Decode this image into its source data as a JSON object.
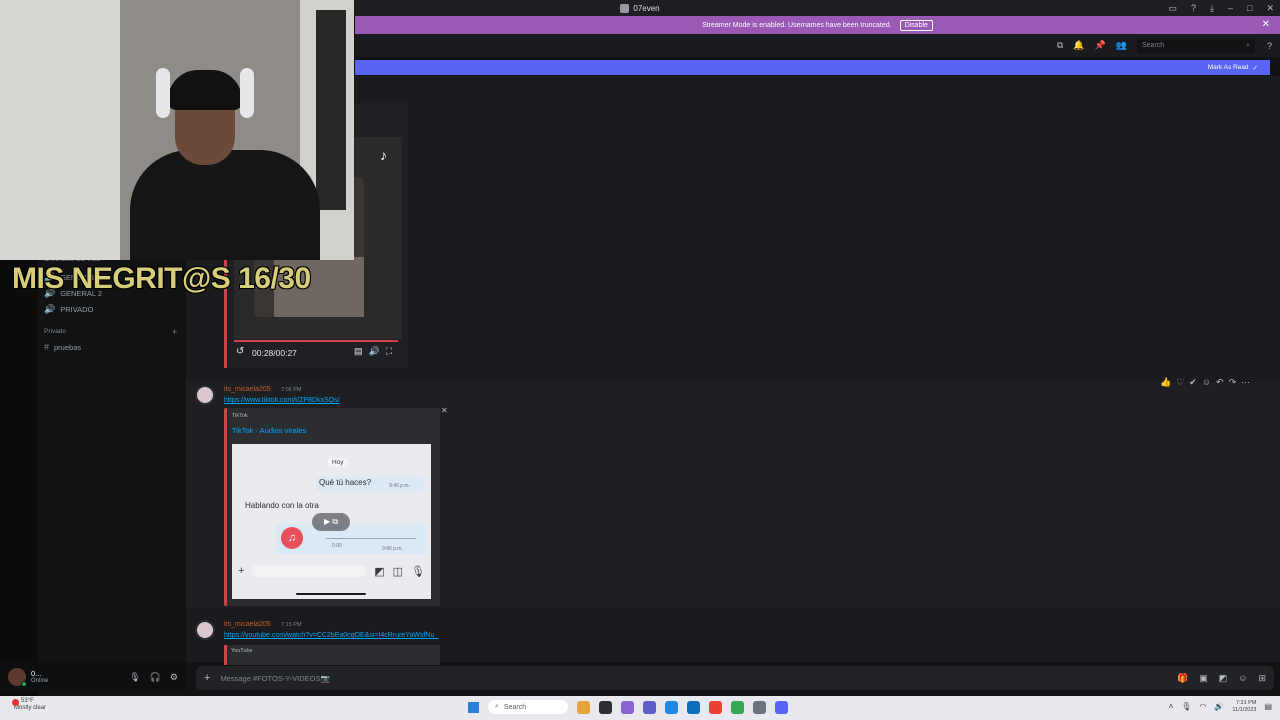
{
  "window": {
    "title": "07even"
  },
  "banner": {
    "text": "Streamer Mode is enabled. Usernames have been truncated.",
    "disable_label": "Disable"
  },
  "header": {
    "search_placeholder": "Search"
  },
  "newbar": {
    "label": "Mark As Read"
  },
  "sidebar": {
    "voice_section": "CANALES DE VOZ",
    "voice_channels": [
      {
        "label": "GENERAL 1"
      },
      {
        "label": "GENERAL 2"
      },
      {
        "label": "PRIVADO"
      }
    ],
    "private_section": "Privado",
    "text_channels": [
      {
        "label": "pruebas"
      }
    ]
  },
  "user": {
    "name": "0...",
    "status": "Online"
  },
  "stream_overlay": {
    "title": "MIS NEGRIT@S 16/30"
  },
  "video": {
    "time": "00:28/00:27"
  },
  "messages": [
    {
      "author": "its_micaela205",
      "time": "7:06 PM",
      "link": "https://www.tiktok.com/t/ZP8DkxSQs/",
      "embed": {
        "provider": "TikTok",
        "title": "TikTok · Audios virales",
        "phone": {
          "day": "Hoy",
          "out_text": "Qué tú haces?",
          "out_time": "9:46 p.m.",
          "in_text": "Hablando con la otra",
          "voice_dur": "0:00",
          "voice_time": "9:46 p.m."
        }
      }
    },
    {
      "author": "its_micaela205",
      "time": "7:15 PM",
      "link": "https://youtube.com/watch?v=CC2bEa0cqOE&si=I4cRrureYaWsfNu_",
      "embed": {
        "provider": "YouTube"
      }
    }
  ],
  "composer": {
    "placeholder": "Message #FOTOS-Y-VIDEOS📷"
  },
  "taskbar": {
    "weather_temp": "53°F",
    "weather_desc": "Mostly clear",
    "search_label": "Search",
    "clock_time": "7:31 PM",
    "clock_date": "11/1/2023"
  },
  "colors": {
    "accent": "#5865f2",
    "banner": "#9b59b6",
    "embed_border": "#d1414b",
    "link": "#00a8fc"
  }
}
